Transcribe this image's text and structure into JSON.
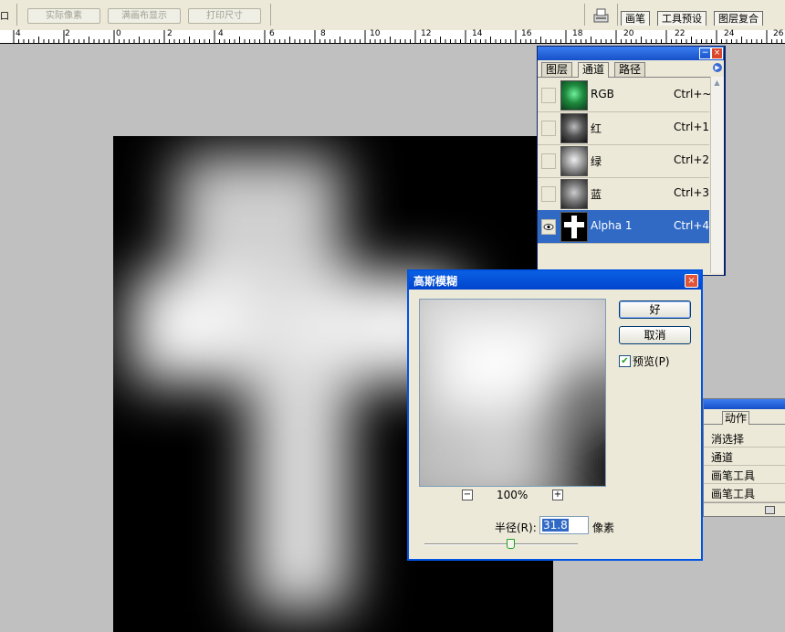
{
  "options_bar": {
    "left_fragment": "口",
    "buttons": [
      "实际像素",
      "满画布显示",
      "打印尺寸"
    ],
    "well_tabs": [
      "画笔",
      "工具预设",
      "图层复合"
    ]
  },
  "ruler": {
    "labels": [
      "4",
      "2",
      "0",
      "2",
      "4",
      "6",
      "8",
      "10",
      "12",
      "14",
      "16",
      "18",
      "20",
      "22",
      "24",
      "26"
    ]
  },
  "channels_panel": {
    "tabs": [
      "图层",
      "通道",
      "路径"
    ],
    "active_tab": "通道",
    "channels": [
      {
        "name": "RGB",
        "shortcut": "Ctrl+~"
      },
      {
        "name": "红",
        "shortcut": "Ctrl+1"
      },
      {
        "name": "绿",
        "shortcut": "Ctrl+2"
      },
      {
        "name": "蓝",
        "shortcut": "Ctrl+3"
      },
      {
        "name": "Alpha 1",
        "shortcut": "Ctrl+4"
      }
    ],
    "selected_channel": "Alpha 1"
  },
  "history_panel": {
    "tab": "动作",
    "items": [
      "消选择",
      "通道",
      "画笔工具",
      "画笔工具"
    ]
  },
  "dialog": {
    "title": "高斯模糊",
    "ok": "好",
    "cancel": "取消",
    "preview_label": "预览(P)",
    "preview_checked": true,
    "zoom": "100%",
    "zoom_minus": "−",
    "zoom_plus": "+",
    "radius_label": "半径(R):",
    "radius_value": "31.8",
    "radius_unit": "像素",
    "slider_fraction": 0.56
  }
}
